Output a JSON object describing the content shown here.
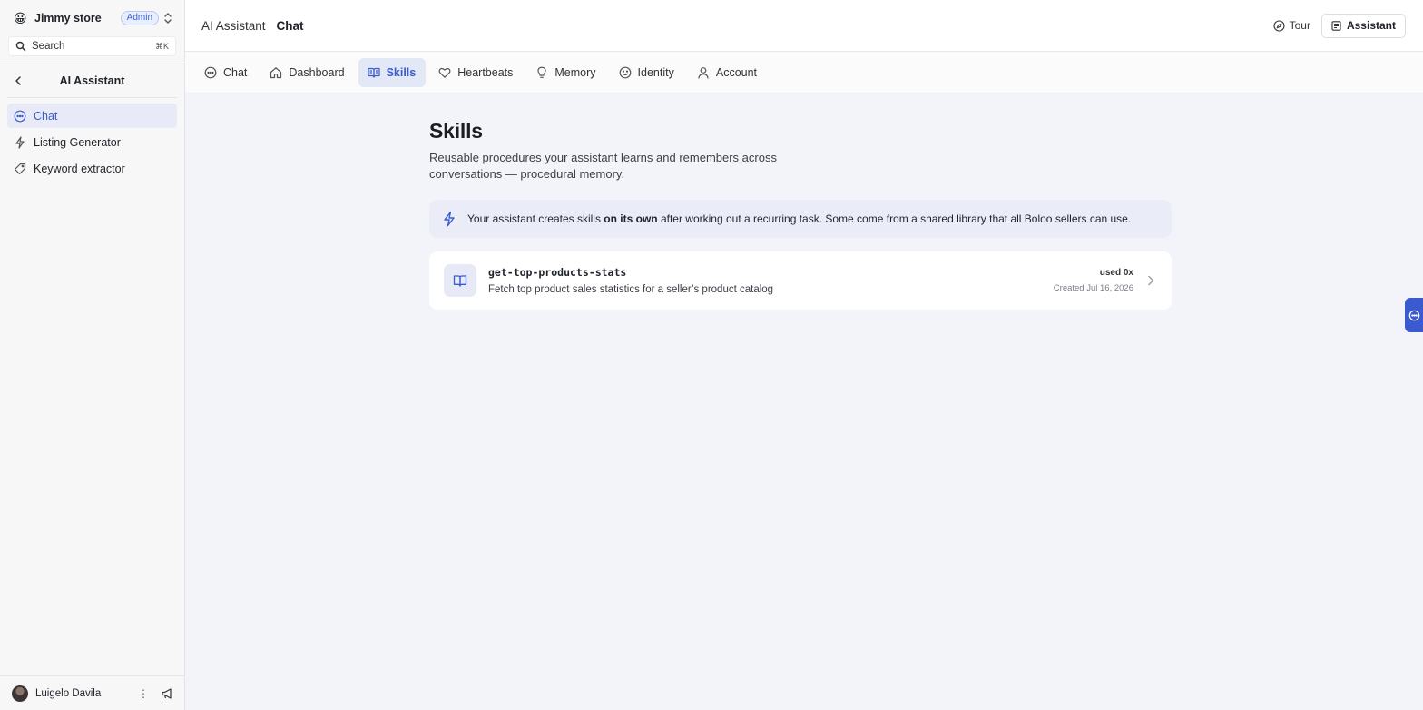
{
  "sidebar": {
    "store_emoji": "😀",
    "store_name": "Jimmy store",
    "role_badge": "Admin",
    "search_label": "Search",
    "search_shortcut": "⌘K",
    "section_title": "AI Assistant",
    "items": [
      {
        "label": "Chat",
        "icon": "chat-bubble-icon",
        "active": true
      },
      {
        "label": "Listing Generator",
        "icon": "lightning-icon",
        "active": false
      },
      {
        "label": "Keyword extractor",
        "icon": "tag-icon",
        "active": false
      }
    ],
    "user_name": "Luigelo Davila"
  },
  "header": {
    "breadcrumb_parent": "AI Assistant",
    "breadcrumb_current": "Chat",
    "tour_label": "Tour",
    "assistant_label": "Assistant"
  },
  "tabs": [
    {
      "label": "Chat",
      "icon": "chat-bubble-icon",
      "active": false
    },
    {
      "label": "Dashboard",
      "icon": "home-icon",
      "active": false
    },
    {
      "label": "Skills",
      "icon": "book-open-icon",
      "active": true
    },
    {
      "label": "Heartbeats",
      "icon": "heart-icon",
      "active": false
    },
    {
      "label": "Memory",
      "icon": "lightbulb-icon",
      "active": false
    },
    {
      "label": "Identity",
      "icon": "smiley-icon",
      "active": false
    },
    {
      "label": "Account",
      "icon": "user-icon",
      "active": false
    }
  ],
  "page": {
    "title": "Skills",
    "description": "Reusable procedures your assistant learns and remembers across conversations — procedural memory.",
    "info_prefix": "Your assistant creates skills ",
    "info_bold": "on its own",
    "info_suffix": " after working out a recurring task. Some come from a shared library that all Boloo sellers can use."
  },
  "skills": [
    {
      "name": "get-top-products-stats",
      "description": "Fetch top product sales statistics for a seller’s product catalog",
      "used": "used 0x",
      "created": "Created Jul 16, 2026"
    }
  ],
  "colors": {
    "accent": "#3a5bd0",
    "active_bg": "#e3e8f7",
    "page_bg": "#f3f4f9"
  }
}
